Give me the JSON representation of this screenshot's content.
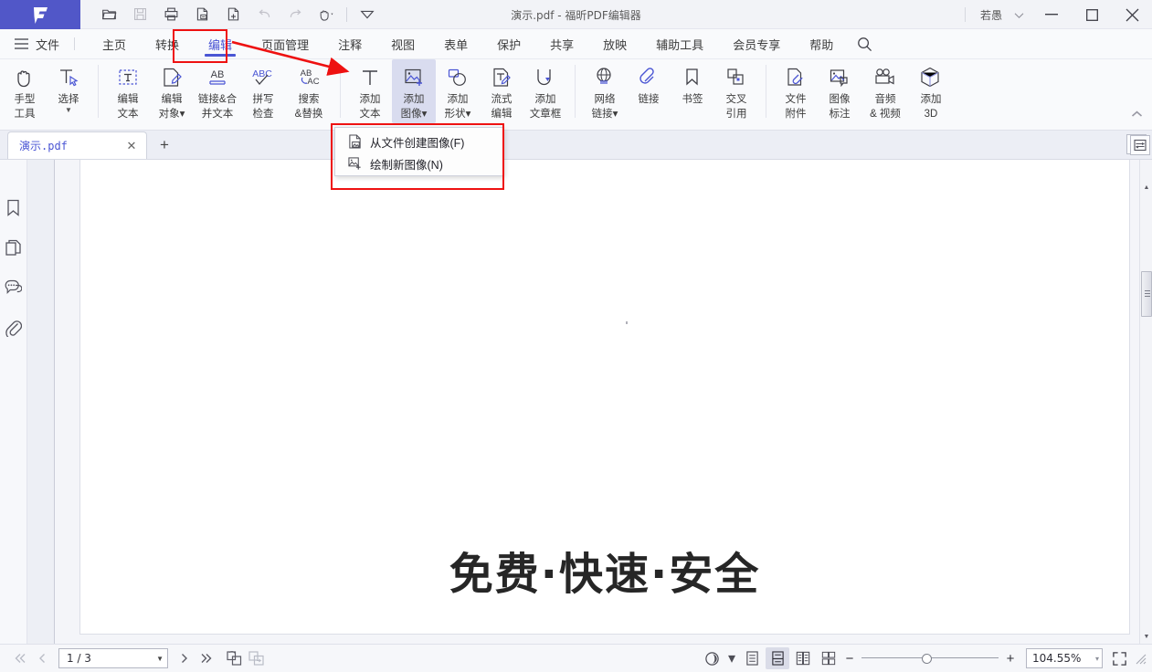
{
  "window": {
    "title": "演示.pdf - 福昕PDF编辑器",
    "user": "若愚",
    "logo_letter": "F",
    "accent_color": "#4a55d4",
    "logo_bg": "#5157c8",
    "annotation_color": "#ee1111",
    "minimize": "—",
    "maximize": "□",
    "close": "✕"
  },
  "quick_access": [
    {
      "name": "open-file-icon",
      "label": "打开"
    },
    {
      "name": "save-icon",
      "label": "保存"
    },
    {
      "name": "print-icon",
      "label": "打印"
    },
    {
      "name": "extract-page-icon",
      "label": "提取页面"
    },
    {
      "name": "new-page-icon",
      "label": "新建页面"
    },
    {
      "name": "undo-icon",
      "label": "撤销"
    },
    {
      "name": "redo-icon",
      "label": "恢复"
    },
    {
      "name": "hand-tool-icon",
      "label": "手型工具"
    },
    {
      "name": "customize-toolbar-icon",
      "label": "自定义"
    }
  ],
  "menubar": {
    "file_label": "文件",
    "tabs": [
      {
        "label": "主页",
        "active": false
      },
      {
        "label": "转换",
        "active": false
      },
      {
        "label": "编辑",
        "active": true
      },
      {
        "label": "页面管理",
        "active": false
      },
      {
        "label": "注释",
        "active": false
      },
      {
        "label": "视图",
        "active": false
      },
      {
        "label": "表单",
        "active": false
      },
      {
        "label": "保护",
        "active": false
      },
      {
        "label": "共享",
        "active": false
      },
      {
        "label": "放映",
        "active": false
      },
      {
        "label": "辅助工具",
        "active": false
      },
      {
        "label": "会员专享",
        "active": false
      },
      {
        "label": "帮助",
        "active": false
      }
    ],
    "search_icon": "search-icon"
  },
  "ribbon": {
    "groups": [
      {
        "items": [
          {
            "icon": "hand-tool-icon",
            "line1": "手型",
            "line2": "工具",
            "caret": false,
            "active": false
          },
          {
            "icon": "select-cursor-icon",
            "line1": "选择",
            "line2": "",
            "caret": true,
            "active": false
          }
        ]
      },
      {
        "items": [
          {
            "icon": "edit-text-icon",
            "line1": "编辑",
            "line2": "文本",
            "caret": false,
            "active": false
          },
          {
            "icon": "edit-object-icon",
            "line1": "编辑",
            "line2": "对象▾",
            "caret": false,
            "active": false
          },
          {
            "icon": "link-merge-text-icon",
            "line1": "链接&合",
            "line2": "并文本",
            "caret": false,
            "active": false
          },
          {
            "icon": "spell-check-icon",
            "line1": "拼写",
            "line2": "检查",
            "caret": false,
            "active": false
          },
          {
            "icon": "search-replace-icon",
            "line1": "搜索",
            "line2": "&替换",
            "caret": false,
            "active": false
          }
        ]
      },
      {
        "items": [
          {
            "icon": "add-text-icon",
            "line1": "添加",
            "line2": "文本",
            "caret": false,
            "active": false
          },
          {
            "icon": "add-image-icon",
            "line1": "添加",
            "line2": "图像▾",
            "caret": false,
            "active": true
          },
          {
            "icon": "add-shape-icon",
            "line1": "添加",
            "line2": "形状▾",
            "caret": false,
            "active": false
          },
          {
            "icon": "reflow-edit-icon",
            "line1": "流式",
            "line2": "编辑",
            "caret": false,
            "active": false
          },
          {
            "icon": "add-article-box-icon",
            "line1": "添加",
            "line2": "文章框",
            "caret": false,
            "active": false
          }
        ]
      },
      {
        "items": [
          {
            "icon": "web-link-icon",
            "line1": "网络",
            "line2": "链接▾",
            "caret": false,
            "active": false
          },
          {
            "icon": "link-icon",
            "line1": "链接",
            "line2": "",
            "caret": false,
            "active": false
          },
          {
            "icon": "bookmark-icon",
            "line1": "书签",
            "line2": "",
            "caret": false,
            "active": false
          },
          {
            "icon": "cross-reference-icon",
            "line1": "交叉",
            "line2": "引用",
            "caret": false,
            "active": false
          }
        ]
      },
      {
        "items": [
          {
            "icon": "file-attachment-icon",
            "line1": "文件",
            "line2": "附件",
            "caret": false,
            "active": false
          },
          {
            "icon": "image-annotation-icon",
            "line1": "图像",
            "line2": "标注",
            "caret": false,
            "active": false
          },
          {
            "icon": "audio-video-icon",
            "line1": "音频",
            "line2": "& 视频",
            "caret": false,
            "active": false
          },
          {
            "icon": "add-3d-icon",
            "line1": "添加",
            "line2": "3D",
            "caret": false,
            "active": false
          }
        ]
      }
    ],
    "collapse_icon": "chevron-up-icon"
  },
  "image_menu": {
    "items": [
      {
        "icon": "create-image-from-file-icon",
        "label": "从文件创建图像(F)"
      },
      {
        "icon": "draw-new-image-icon",
        "label": "绘制新图像(N)"
      }
    ]
  },
  "tabstrip": {
    "tabs": [
      {
        "name": "演示.pdf",
        "close": "✕"
      }
    ],
    "new_tab": "+",
    "split_view_icon": "split-view-icon"
  },
  "left_rail": {
    "items": [
      {
        "icon": "bookmark-panel-icon",
        "label": "书签"
      },
      {
        "icon": "pages-panel-icon",
        "label": "页面缩略图"
      },
      {
        "icon": "comments-panel-icon",
        "label": "注释"
      },
      {
        "icon": "attachments-panel-icon",
        "label": "附件"
      }
    ],
    "expand_icon": "expand-panel-icon"
  },
  "document": {
    "heading": "免费·快速·安全"
  },
  "status_bar": {
    "first_page_icon": "first-page-icon",
    "prev_page_icon": "prev-page-icon",
    "page_value": "1 / 3",
    "page_caret": "▼",
    "next_page_icon": "next-page-icon",
    "last_page_icon": "last-page-icon",
    "rotate_view_icon": "rotate-view-icon",
    "page_transition_icon": "page-transition-icon",
    "theme_icon": "theme-icon",
    "theme_caret": "▾",
    "view_modes": [
      {
        "icon": "single-page-view-icon",
        "active": false
      },
      {
        "icon": "continuous-view-icon",
        "active": true
      },
      {
        "icon": "two-page-view-icon",
        "active": false
      },
      {
        "icon": "two-page-continuous-view-icon",
        "active": false
      }
    ],
    "zoom_out": "−",
    "zoom_in": "+",
    "zoom_value": "104.55%",
    "zoom_caret": "▾",
    "fullscreen_icon": "fullscreen-icon",
    "resize-grip": "resize-grip"
  }
}
